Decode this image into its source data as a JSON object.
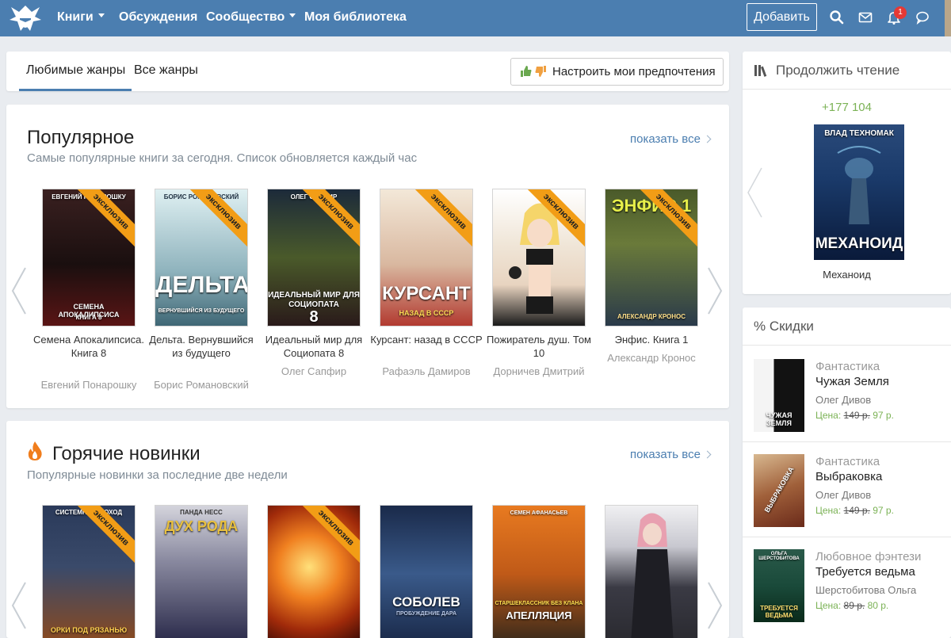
{
  "nav": {
    "items": [
      {
        "label": "Книги",
        "caret": true
      },
      {
        "label": "Обсуждения",
        "caret": false
      },
      {
        "label": "Сообщество",
        "caret": true
      },
      {
        "label": "Моя библиотека",
        "caret": false
      }
    ],
    "add_label": "Добавить",
    "notifications_count": "1",
    "icons": [
      "search-icon",
      "mail-icon",
      "bell-icon",
      "chat-icon"
    ],
    "brand_color": "#4b7eb0"
  },
  "tabs": {
    "items": [
      "Любимые жанры",
      "Все жанры"
    ],
    "active": 0,
    "preferences_label": "Настроить мои предпочтения"
  },
  "popular": {
    "title": "Популярное",
    "subtitle": "Самые популярные книги за сегодня. Список обновляется каждый час",
    "show_all": "показать все",
    "books": [
      {
        "title": "Семена Апокалипсиса. Книга 8",
        "author": "Евгений Понарошку",
        "exclusive": true,
        "cover_top": "ЕВГЕНИЙ ПОНАРОШКУ",
        "cover_main": "СЕМЕНА АПОКАЛИПСИСА",
        "cover_sub": "КНИГА 8",
        "colors": [
          "#2a1a1a",
          "#6a2020"
        ]
      },
      {
        "title": "Дельта. Вернувшийся из будущего",
        "author": "Борис Романовский",
        "exclusive": true,
        "cover_top": "БОРИС РОМАНОВСКИЙ",
        "cover_main": "ДЕЛЬТА",
        "cover_sub": "ВЕРНУВШИЙСЯ ИЗ БУДУЩЕГО",
        "colors": [
          "#cfe6ec",
          "#4f7b8a"
        ]
      },
      {
        "title": "Идеальный мир для Социопата 8",
        "author": "Олег Сапфир",
        "exclusive": true,
        "cover_top": "ОЛЕГ САПФИР",
        "cover_main": "ИДЕАЛЬНЫЙ МИР ДЛЯ СОЦИОПАТА",
        "cover_sub": "8",
        "colors": [
          "#3a5a2a",
          "#1c2a3a"
        ]
      },
      {
        "title": "Курсант: назад в СССР",
        "author": "Рафаэль Дамиров",
        "exclusive": true,
        "cover_top": "",
        "cover_main": "КУРСАНТ",
        "cover_sub": "НАЗАД В СССР",
        "colors": [
          "#e8d9c5",
          "#c0392b"
        ]
      },
      {
        "title": "Пожиратель душ. Том 10",
        "author": "Дорничев Дмитрий",
        "exclusive": true,
        "cover_top": "",
        "cover_main": "",
        "cover_sub": "",
        "colors": [
          "#f5f5f5",
          "#d8d8d8"
        ]
      },
      {
        "title": "Энфис. Книга 1",
        "author": "Александр Кронос",
        "exclusive": true,
        "cover_top": "",
        "cover_main": "ЭНФИС 1",
        "cover_sub": "АЛЕКСАНДР КРОНОС",
        "colors": [
          "#5b6a3a",
          "#2b3a4a"
        ]
      }
    ]
  },
  "hot": {
    "title": "Горячие новинки",
    "subtitle": "Популярные новинки за последние две недели",
    "show_all": "показать все",
    "books": [
      {
        "exclusive": true,
        "cover_top": "СИСТЕМНЫЙ ПОХОД",
        "cover_main": "ОРКИ ПОД РЯЗАНЬЮ",
        "colors": [
          "#2a3a5a",
          "#8a4a20"
        ]
      },
      {
        "exclusive": false,
        "cover_top": "ПАНДА НЕСС",
        "cover_main": "ДУХ РОДА",
        "colors": [
          "#cfcfd6",
          "#4a4a6a"
        ]
      },
      {
        "exclusive": true,
        "cover_top": "",
        "cover_main": "",
        "colors": [
          "#f0a030",
          "#8a1a0a"
        ]
      },
      {
        "exclusive": false,
        "cover_top": "",
        "cover_main": "СОБОЛЕВ",
        "cover_sub": "ПРОБУЖДЕНИЕ ДАРА",
        "colors": [
          "#1a2a4a",
          "#4a6a9a"
        ]
      },
      {
        "exclusive": false,
        "cover_top": "СЕМЕН АФАНАСЬЕВ",
        "cover_main": "АПЕЛЛЯЦИЯ",
        "cover_sub": "СТАРШЕКЛАССНИК БЕЗ КЛАНА",
        "colors": [
          "#e87a20",
          "#3a2a1a"
        ]
      },
      {
        "exclusive": false,
        "cover_top": "",
        "cover_main": "",
        "colors": [
          "#e8e8ea",
          "#3a3a44"
        ]
      }
    ]
  },
  "continue_reading": {
    "title": "Продолжить чтение",
    "count": "+177 104",
    "book_title": "Механоид",
    "cover_top": "ВЛАД ТЕХНОМАК",
    "cover_main": "МЕХАНОИД",
    "colors": [
      "#1a3a6a",
      "#0a1a3a"
    ]
  },
  "discounts": {
    "title": "% Скидки",
    "price_label": "Цена:",
    "items": [
      {
        "genre": "Фантастика",
        "title": "Чужая Земля",
        "author": "Олег Дивов",
        "old_price": "149 р.",
        "new_price": "97 р.",
        "cover_main": "ЧУЖАЯ ЗЕМЛЯ",
        "colors": [
          "#f2f2f2",
          "#111111"
        ]
      },
      {
        "genre": "Фантастика",
        "title": "Выбраковка",
        "author": "Олег Дивов",
        "old_price": "149 р.",
        "new_price": "97 р.",
        "cover_main": "ВЫБРАКОВКА",
        "colors": [
          "#c8a07a",
          "#8a3a1a"
        ]
      },
      {
        "genre": "Любовное фэнтези",
        "title": "Требуется ведьма",
        "author": "Шерстобитова Ольга",
        "old_price": "89 р.",
        "new_price": "80 р.",
        "cover_main": "ТРЕБУЕТСЯ ВЕДЬМА",
        "cover_top": "ОЛЬГА ШЕРСТОБИТОВА",
        "colors": [
          "#1a4a3a",
          "#0a2a1a"
        ]
      }
    ]
  },
  "exclusive_label": "эксклюзив"
}
